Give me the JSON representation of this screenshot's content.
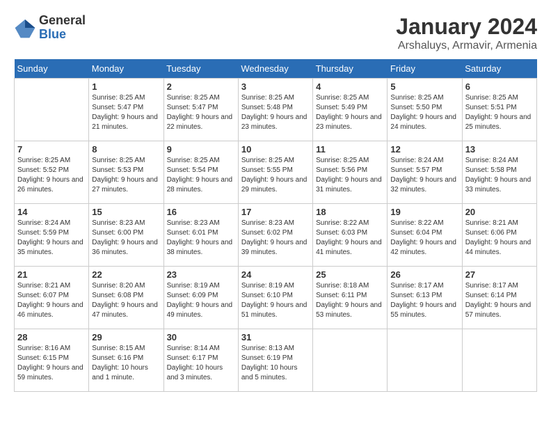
{
  "header": {
    "logo": {
      "general": "General",
      "blue": "Blue"
    },
    "title": "January 2024",
    "subtitle": "Arshaluys, Armavir, Armenia"
  },
  "calendar": {
    "days_of_week": [
      "Sunday",
      "Monday",
      "Tuesday",
      "Wednesday",
      "Thursday",
      "Friday",
      "Saturday"
    ],
    "weeks": [
      [
        {
          "day": "",
          "sunrise": "",
          "sunset": "",
          "daylight": ""
        },
        {
          "day": "1",
          "sunrise": "Sunrise: 8:25 AM",
          "sunset": "Sunset: 5:47 PM",
          "daylight": "Daylight: 9 hours and 21 minutes."
        },
        {
          "day": "2",
          "sunrise": "Sunrise: 8:25 AM",
          "sunset": "Sunset: 5:47 PM",
          "daylight": "Daylight: 9 hours and 22 minutes."
        },
        {
          "day": "3",
          "sunrise": "Sunrise: 8:25 AM",
          "sunset": "Sunset: 5:48 PM",
          "daylight": "Daylight: 9 hours and 23 minutes."
        },
        {
          "day": "4",
          "sunrise": "Sunrise: 8:25 AM",
          "sunset": "Sunset: 5:49 PM",
          "daylight": "Daylight: 9 hours and 23 minutes."
        },
        {
          "day": "5",
          "sunrise": "Sunrise: 8:25 AM",
          "sunset": "Sunset: 5:50 PM",
          "daylight": "Daylight: 9 hours and 24 minutes."
        },
        {
          "day": "6",
          "sunrise": "Sunrise: 8:25 AM",
          "sunset": "Sunset: 5:51 PM",
          "daylight": "Daylight: 9 hours and 25 minutes."
        }
      ],
      [
        {
          "day": "7",
          "sunrise": "Sunrise: 8:25 AM",
          "sunset": "Sunset: 5:52 PM",
          "daylight": "Daylight: 9 hours and 26 minutes."
        },
        {
          "day": "8",
          "sunrise": "Sunrise: 8:25 AM",
          "sunset": "Sunset: 5:53 PM",
          "daylight": "Daylight: 9 hours and 27 minutes."
        },
        {
          "day": "9",
          "sunrise": "Sunrise: 8:25 AM",
          "sunset": "Sunset: 5:54 PM",
          "daylight": "Daylight: 9 hours and 28 minutes."
        },
        {
          "day": "10",
          "sunrise": "Sunrise: 8:25 AM",
          "sunset": "Sunset: 5:55 PM",
          "daylight": "Daylight: 9 hours and 29 minutes."
        },
        {
          "day": "11",
          "sunrise": "Sunrise: 8:25 AM",
          "sunset": "Sunset: 5:56 PM",
          "daylight": "Daylight: 9 hours and 31 minutes."
        },
        {
          "day": "12",
          "sunrise": "Sunrise: 8:24 AM",
          "sunset": "Sunset: 5:57 PM",
          "daylight": "Daylight: 9 hours and 32 minutes."
        },
        {
          "day": "13",
          "sunrise": "Sunrise: 8:24 AM",
          "sunset": "Sunset: 5:58 PM",
          "daylight": "Daylight: 9 hours and 33 minutes."
        }
      ],
      [
        {
          "day": "14",
          "sunrise": "Sunrise: 8:24 AM",
          "sunset": "Sunset: 5:59 PM",
          "daylight": "Daylight: 9 hours and 35 minutes."
        },
        {
          "day": "15",
          "sunrise": "Sunrise: 8:23 AM",
          "sunset": "Sunset: 6:00 PM",
          "daylight": "Daylight: 9 hours and 36 minutes."
        },
        {
          "day": "16",
          "sunrise": "Sunrise: 8:23 AM",
          "sunset": "Sunset: 6:01 PM",
          "daylight": "Daylight: 9 hours and 38 minutes."
        },
        {
          "day": "17",
          "sunrise": "Sunrise: 8:23 AM",
          "sunset": "Sunset: 6:02 PM",
          "daylight": "Daylight: 9 hours and 39 minutes."
        },
        {
          "day": "18",
          "sunrise": "Sunrise: 8:22 AM",
          "sunset": "Sunset: 6:03 PM",
          "daylight": "Daylight: 9 hours and 41 minutes."
        },
        {
          "day": "19",
          "sunrise": "Sunrise: 8:22 AM",
          "sunset": "Sunset: 6:04 PM",
          "daylight": "Daylight: 9 hours and 42 minutes."
        },
        {
          "day": "20",
          "sunrise": "Sunrise: 8:21 AM",
          "sunset": "Sunset: 6:06 PM",
          "daylight": "Daylight: 9 hours and 44 minutes."
        }
      ],
      [
        {
          "day": "21",
          "sunrise": "Sunrise: 8:21 AM",
          "sunset": "Sunset: 6:07 PM",
          "daylight": "Daylight: 9 hours and 46 minutes."
        },
        {
          "day": "22",
          "sunrise": "Sunrise: 8:20 AM",
          "sunset": "Sunset: 6:08 PM",
          "daylight": "Daylight: 9 hours and 47 minutes."
        },
        {
          "day": "23",
          "sunrise": "Sunrise: 8:19 AM",
          "sunset": "Sunset: 6:09 PM",
          "daylight": "Daylight: 9 hours and 49 minutes."
        },
        {
          "day": "24",
          "sunrise": "Sunrise: 8:19 AM",
          "sunset": "Sunset: 6:10 PM",
          "daylight": "Daylight: 9 hours and 51 minutes."
        },
        {
          "day": "25",
          "sunrise": "Sunrise: 8:18 AM",
          "sunset": "Sunset: 6:11 PM",
          "daylight": "Daylight: 9 hours and 53 minutes."
        },
        {
          "day": "26",
          "sunrise": "Sunrise: 8:17 AM",
          "sunset": "Sunset: 6:13 PM",
          "daylight": "Daylight: 9 hours and 55 minutes."
        },
        {
          "day": "27",
          "sunrise": "Sunrise: 8:17 AM",
          "sunset": "Sunset: 6:14 PM",
          "daylight": "Daylight: 9 hours and 57 minutes."
        }
      ],
      [
        {
          "day": "28",
          "sunrise": "Sunrise: 8:16 AM",
          "sunset": "Sunset: 6:15 PM",
          "daylight": "Daylight: 9 hours and 59 minutes."
        },
        {
          "day": "29",
          "sunrise": "Sunrise: 8:15 AM",
          "sunset": "Sunset: 6:16 PM",
          "daylight": "Daylight: 10 hours and 1 minute."
        },
        {
          "day": "30",
          "sunrise": "Sunrise: 8:14 AM",
          "sunset": "Sunset: 6:17 PM",
          "daylight": "Daylight: 10 hours and 3 minutes."
        },
        {
          "day": "31",
          "sunrise": "Sunrise: 8:13 AM",
          "sunset": "Sunset: 6:19 PM",
          "daylight": "Daylight: 10 hours and 5 minutes."
        },
        {
          "day": "",
          "sunrise": "",
          "sunset": "",
          "daylight": ""
        },
        {
          "day": "",
          "sunrise": "",
          "sunset": "",
          "daylight": ""
        },
        {
          "day": "",
          "sunrise": "",
          "sunset": "",
          "daylight": ""
        }
      ]
    ]
  }
}
